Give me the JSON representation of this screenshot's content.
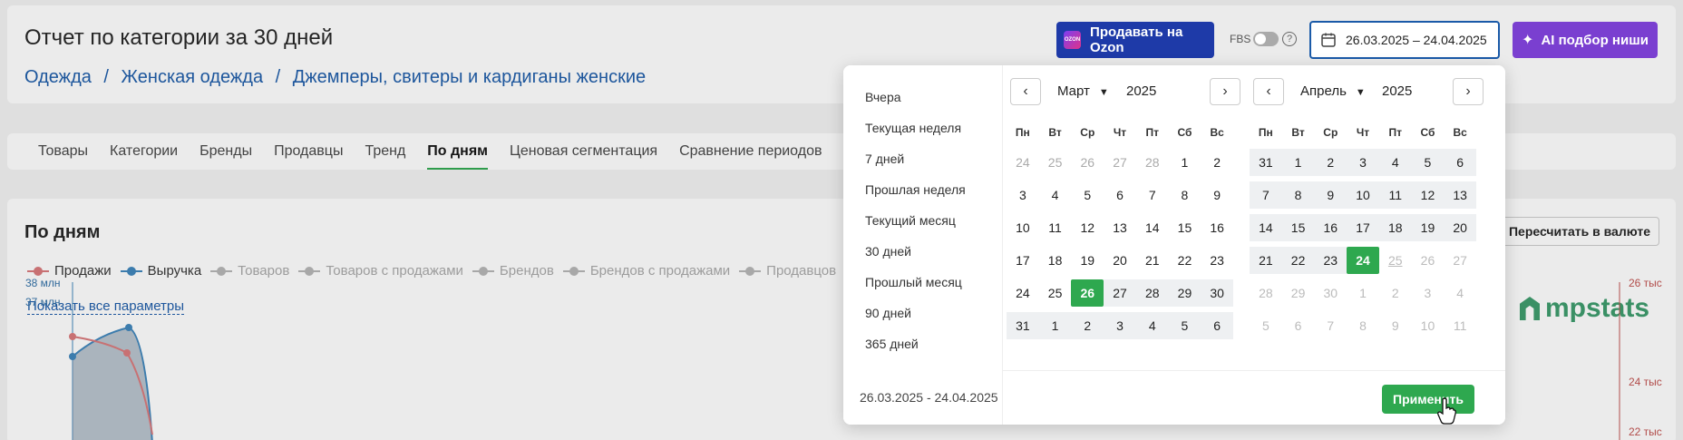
{
  "header": {
    "title": "Отчет по категории за 30 дней",
    "breadcrumb": [
      "Одежда",
      "Женская одежда",
      "Джемперы, свитеры и кардиганы женские"
    ],
    "breadcrumb_sep": "/"
  },
  "tabs": [
    {
      "label": "Товары"
    },
    {
      "label": "Категории"
    },
    {
      "label": "Бренды"
    },
    {
      "label": "Продавцы"
    },
    {
      "label": "Тренд"
    },
    {
      "label": "По дням",
      "active": true
    },
    {
      "label": "Ценовая сегментация"
    },
    {
      "label": "Сравнение периодов"
    }
  ],
  "toolbar": {
    "ozon_label": "Продавать на Ozon",
    "ozon_icon_text": "OZON",
    "fbs_label": "FBS",
    "fbs_enabled": false,
    "help_label": "?",
    "date_range": "26.03.2025 – 24.04.2025",
    "ai_label": "AI подбор ниши"
  },
  "section": {
    "title": "По дням",
    "recalc_label": "Пересчитать в валюте",
    "show_all_label": "Показать все параметры",
    "legend": [
      {
        "label": "Продажи",
        "color": "#d9787a",
        "muted": false
      },
      {
        "label": "Выручка",
        "color": "#3d84ba",
        "muted": false
      },
      {
        "label": "Товаров",
        "color": "#b5b5b5",
        "muted": true
      },
      {
        "label": "Товаров с продажами",
        "color": "#b5b5b5",
        "muted": true
      },
      {
        "label": "Брендов",
        "color": "#b5b5b5",
        "muted": true
      },
      {
        "label": "Брендов с продажами",
        "color": "#b5b5b5",
        "muted": true
      },
      {
        "label": "Продавцов",
        "color": "#b5b5b5",
        "muted": true
      }
    ],
    "logo_text": "mpstats",
    "y_left": [
      "38 млн",
      "37 млн"
    ],
    "y_right": [
      "26 тыс",
      "24 тыс",
      "22 тыс"
    ]
  },
  "picker": {
    "presets": [
      "Вчера",
      "Текущая неделя",
      "7 дней",
      "Прошлая неделя",
      "Текущий месяц",
      "30 дней",
      "Прошлый месяц",
      "90 дней",
      "365 дней"
    ],
    "range_label": "26.03.2025 - 24.04.2025",
    "apply_label": "Применить",
    "weekdays": [
      "Пн",
      "Вт",
      "Ср",
      "Чт",
      "Пт",
      "Сб",
      "Вс"
    ],
    "left": {
      "month": "Март",
      "year": "2025",
      "weeks": [
        [
          [
            "24",
            "muted"
          ],
          [
            "25",
            "muted"
          ],
          [
            "26",
            "muted"
          ],
          [
            "27",
            "muted"
          ],
          [
            "28",
            "muted"
          ],
          [
            "1",
            ""
          ],
          [
            "2",
            ""
          ]
        ],
        [
          [
            "3",
            ""
          ],
          [
            "4",
            ""
          ],
          [
            "5",
            ""
          ],
          [
            "6",
            ""
          ],
          [
            "7",
            ""
          ],
          [
            "8",
            ""
          ],
          [
            "9",
            ""
          ]
        ],
        [
          [
            "10",
            ""
          ],
          [
            "11",
            ""
          ],
          [
            "12",
            ""
          ],
          [
            "13",
            ""
          ],
          [
            "14",
            ""
          ],
          [
            "15",
            ""
          ],
          [
            "16",
            ""
          ]
        ],
        [
          [
            "17",
            ""
          ],
          [
            "18",
            ""
          ],
          [
            "19",
            ""
          ],
          [
            "20",
            ""
          ],
          [
            "21",
            ""
          ],
          [
            "22",
            ""
          ],
          [
            "23",
            ""
          ]
        ],
        [
          [
            "24",
            ""
          ],
          [
            "25",
            ""
          ],
          [
            "26",
            "selected"
          ],
          [
            "27",
            "inrange"
          ],
          [
            "28",
            "inrange"
          ],
          [
            "29",
            "inrange"
          ],
          [
            "30",
            "inrange"
          ]
        ],
        [
          [
            "31",
            "inrange"
          ],
          [
            "1",
            "inrange"
          ],
          [
            "2",
            "inrange"
          ],
          [
            "3",
            "inrange"
          ],
          [
            "4",
            "inrange"
          ],
          [
            "5",
            "inrange"
          ],
          [
            "6",
            "inrange"
          ]
        ]
      ]
    },
    "right": {
      "month": "Апрель",
      "year": "2025",
      "weeks": [
        [
          [
            "31",
            "inrange"
          ],
          [
            "1",
            "inrange"
          ],
          [
            "2",
            "inrange"
          ],
          [
            "3",
            "inrange"
          ],
          [
            "4",
            "inrange"
          ],
          [
            "5",
            "inrange"
          ],
          [
            "6",
            "inrange"
          ]
        ],
        [
          [
            "7",
            "inrange"
          ],
          [
            "8",
            "inrange"
          ],
          [
            "9",
            "inrange"
          ],
          [
            "10",
            "inrange"
          ],
          [
            "11",
            "inrange"
          ],
          [
            "12",
            "inrange"
          ],
          [
            "13",
            "inrange"
          ]
        ],
        [
          [
            "14",
            "inrange"
          ],
          [
            "15",
            "inrange"
          ],
          [
            "16",
            "inrange"
          ],
          [
            "17",
            "inrange"
          ],
          [
            "18",
            "inrange"
          ],
          [
            "19",
            "inrange"
          ],
          [
            "20",
            "inrange"
          ]
        ],
        [
          [
            "21",
            "inrange"
          ],
          [
            "22",
            "inrange"
          ],
          [
            "23",
            "inrange"
          ],
          [
            "24",
            "selected"
          ],
          [
            "25",
            "faded today"
          ],
          [
            "26",
            "faded"
          ],
          [
            "27",
            "faded"
          ]
        ],
        [
          [
            "28",
            "faded"
          ],
          [
            "29",
            "faded"
          ],
          [
            "30",
            "faded"
          ],
          [
            "1",
            "faded"
          ],
          [
            "2",
            "faded"
          ],
          [
            "3",
            "faded"
          ],
          [
            "4",
            "faded"
          ]
        ],
        [
          [
            "5",
            "faded"
          ],
          [
            "6",
            "faded"
          ],
          [
            "7",
            "faded"
          ],
          [
            "8",
            "faded"
          ],
          [
            "9",
            "faded"
          ],
          [
            "10",
            "faded"
          ],
          [
            "11",
            "faded"
          ]
        ]
      ]
    }
  }
}
